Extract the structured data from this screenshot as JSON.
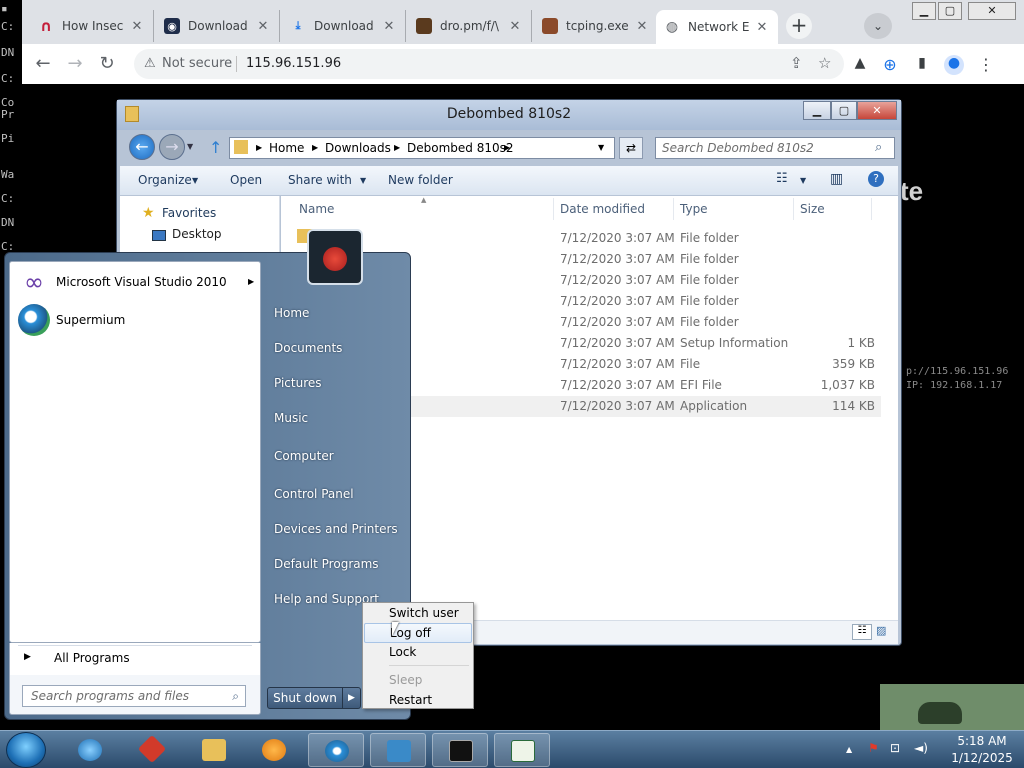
{
  "chrome": {
    "tabs": [
      {
        "label": "How Insec",
        "icon": "n-logo-icon",
        "color": "#c41e3a"
      },
      {
        "label": "Download",
        "icon": "eye-logo-icon",
        "color": "#1f2d4a"
      },
      {
        "label": "Download",
        "icon": "download-icon",
        "color": "#1a73e8"
      },
      {
        "label": "dro.pm/f/\\",
        "icon": "image-favicon",
        "color": "#5a3a1e"
      },
      {
        "label": "tcping.exe",
        "icon": "person-favicon",
        "color": "#8b4a2a"
      },
      {
        "label": "Network E",
        "icon": "globe-icon",
        "color": "#5f6368"
      }
    ],
    "address": {
      "security": "Not secure",
      "url": "115.96.151.96"
    }
  },
  "explorer": {
    "title": "Debombed 810s2",
    "breadcrumb": [
      "Home",
      "Downloads",
      "Debombed 810s2"
    ],
    "search_placeholder": "Search Debombed 810s2",
    "commands": [
      "Organize",
      "Open",
      "Share with",
      "New folder"
    ],
    "nav": {
      "favorites": "Favorites",
      "desktop": "Desktop"
    },
    "columns": [
      "Name",
      "Date modified",
      "Type",
      "Size"
    ],
    "rows": [
      {
        "date": "7/12/2020 3:07 AM",
        "type": "File folder",
        "size": ""
      },
      {
        "date": "7/12/2020 3:07 AM",
        "type": "File folder",
        "size": ""
      },
      {
        "date": "7/12/2020 3:07 AM",
        "type": "File folder",
        "size": ""
      },
      {
        "date": "7/12/2020 3:07 AM",
        "type": "File folder",
        "size": ""
      },
      {
        "date": "7/12/2020 3:07 AM",
        "type": "File folder",
        "size": ""
      },
      {
        "date": "7/12/2020 3:07 AM",
        "type": "Setup Information",
        "size": "1 KB"
      },
      {
        "date": "7/12/2020 3:07 AM",
        "type": "File",
        "size": "359 KB"
      },
      {
        "date": "7/12/2020 3:07 AM",
        "type": "EFI File",
        "size": "1,037 KB"
      },
      {
        "date": "7/12/2020 3:07 AM",
        "type": "Application",
        "size": "114 KB"
      }
    ]
  },
  "start_menu": {
    "programs": [
      {
        "label": "Microsoft Visual Studio 2010",
        "icon": "visual-studio-icon"
      },
      {
        "label": "Supermium",
        "icon": "supermium-icon"
      }
    ],
    "all_programs": "All Programs",
    "search_placeholder": "Search programs and files",
    "right": [
      "Home",
      "Documents",
      "Pictures",
      "Music",
      "Computer",
      "Control Panel",
      "Devices and Printers",
      "Default Programs",
      "Help and Support"
    ],
    "shutdown": "Shut down"
  },
  "context_menu": {
    "items": [
      "Switch user",
      "Log off",
      "Lock",
      "Sleep",
      "Restart"
    ]
  },
  "desktop": {
    "cmd_lines": [
      "C:",
      "DN",
      "C:",
      "Co",
      "Pr",
      "Pi",
      "Wa",
      "C:",
      "DN",
      "C:"
    ],
    "big_text": "te",
    "overlay_url": "p://115.96.151.96",
    "overlay_ip": "IP: 192.168.1.17"
  },
  "taskbar": {
    "time": "5:18 AM",
    "date": "1/12/2025"
  },
  "colors": {
    "accent": "#1a73e8",
    "taskbar": "#2b4a6b"
  }
}
